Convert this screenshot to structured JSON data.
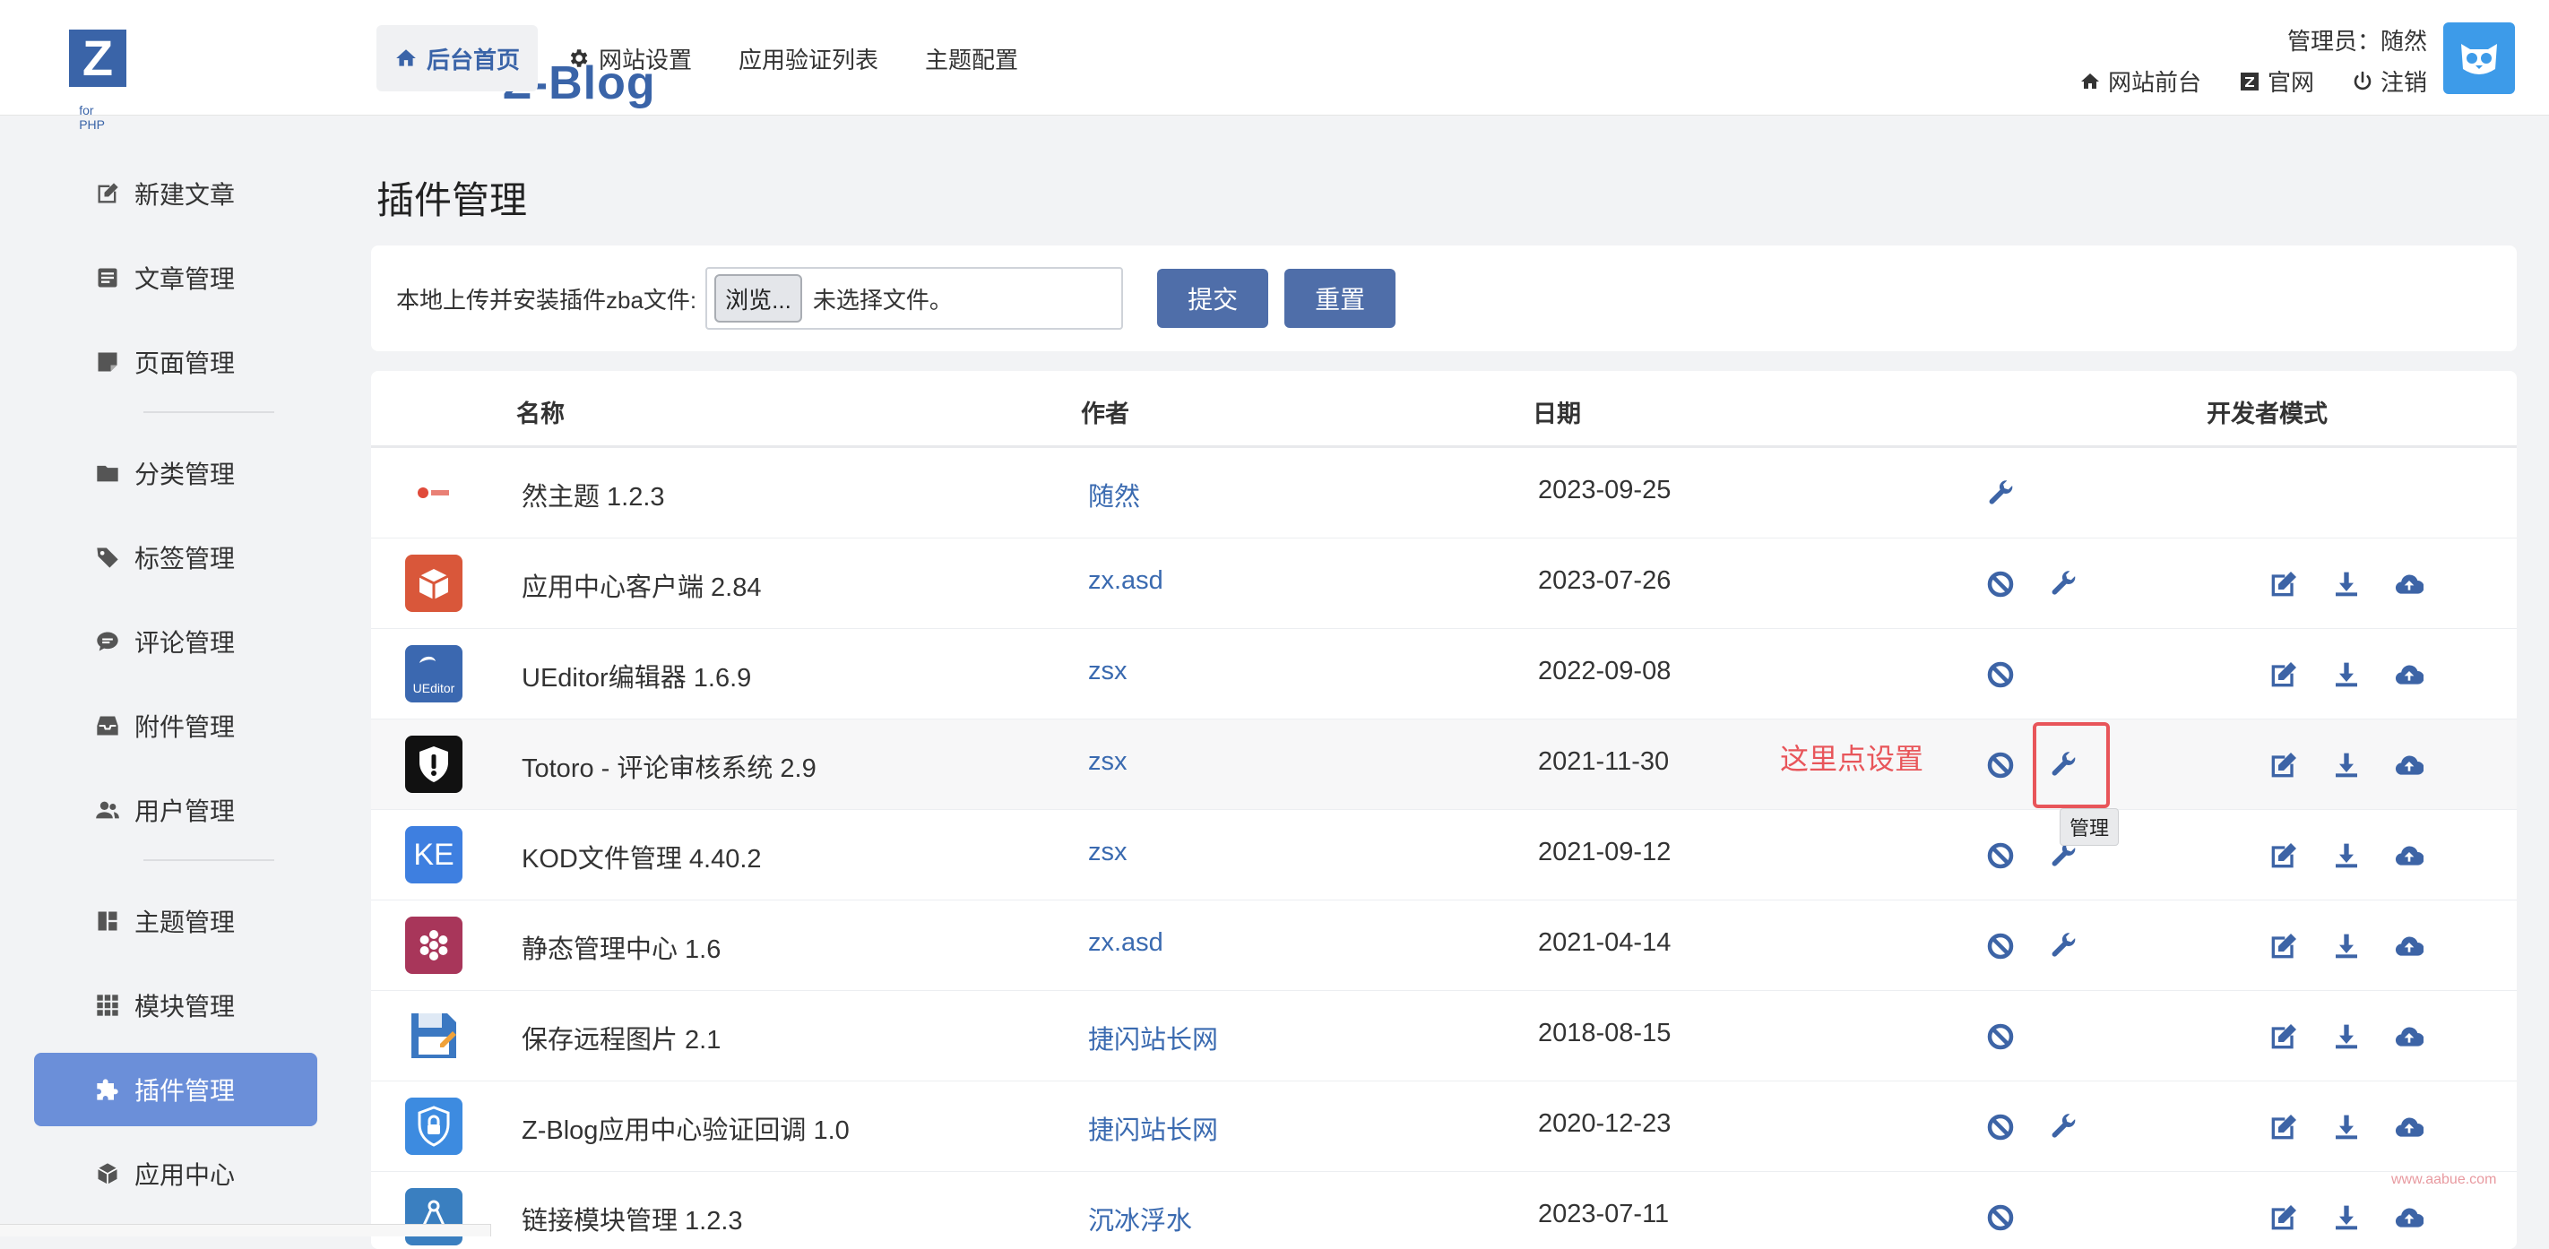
{
  "logo": {
    "letter": "Z",
    "text": "Z-Blog",
    "sub": "for PHP"
  },
  "topnav": [
    {
      "label": "后台首页",
      "icon": "home-icon",
      "active": true
    },
    {
      "label": "网站设置",
      "icon": "gear-icon",
      "active": false
    },
    {
      "label": "应用验证列表",
      "icon": "",
      "active": false
    },
    {
      "label": "主题配置",
      "icon": "",
      "active": false
    }
  ],
  "admin": {
    "label": "管理员：随然",
    "links": [
      {
        "label": "网站前台",
        "icon": "home-icon"
      },
      {
        "label": "官网",
        "icon": "z-logo-icon"
      },
      {
        "label": "注销",
        "icon": "power-icon"
      }
    ]
  },
  "sidebar": {
    "items": [
      {
        "label": "新建文章",
        "icon": "edit-icon"
      },
      {
        "label": "文章管理",
        "icon": "list-icon"
      },
      {
        "label": "页面管理",
        "icon": "page-icon"
      },
      {
        "label": "分类管理",
        "icon": "folder-icon"
      },
      {
        "label": "标签管理",
        "icon": "tag-icon"
      },
      {
        "label": "评论管理",
        "icon": "comment-icon"
      },
      {
        "label": "附件管理",
        "icon": "inbox-icon"
      },
      {
        "label": "用户管理",
        "icon": "users-icon"
      },
      {
        "label": "主题管理",
        "icon": "layout-icon"
      },
      {
        "label": "模块管理",
        "icon": "grid-icon"
      },
      {
        "label": "插件管理",
        "icon": "puzzle-icon",
        "active": true
      },
      {
        "label": "应用中心",
        "icon": "cube-icon"
      }
    ]
  },
  "page_title": "插件管理",
  "upload": {
    "label": "本地上传并安装插件zba文件:",
    "browse_label": "浏览...",
    "file_status": "未选择文件。",
    "submit_label": "提交",
    "reset_label": "重置"
  },
  "table": {
    "headers": {
      "name": "名称",
      "author": "作者",
      "date": "日期",
      "dev": "开发者模式"
    },
    "rows": [
      {
        "name": "然主题 1.2.3",
        "author": "随然",
        "date": "2023-09-25",
        "icon": "ran-theme-icon",
        "disable": false,
        "manage": true,
        "dev": false
      },
      {
        "name": "应用中心客户端 2.84",
        "author": "zx.asd",
        "date": "2023-07-26",
        "icon": "app-center-icon",
        "disable": true,
        "manage": true,
        "dev": true
      },
      {
        "name": "UEditor编辑器 1.6.9",
        "author": "zsx",
        "date": "2022-09-08",
        "icon": "ueditor-icon",
        "disable": true,
        "manage": false,
        "dev": true
      },
      {
        "name": "Totoro - 评论审核系统 2.9",
        "author": "zsx",
        "date": "2021-11-30",
        "icon": "shield-icon",
        "disable": true,
        "manage": true,
        "dev": true
      },
      {
        "name": "KOD文件管理 4.40.2",
        "author": "zsx",
        "date": "2021-09-12",
        "icon": "kod-icon",
        "disable": true,
        "manage": true,
        "dev": true
      },
      {
        "name": "静态管理中心 1.6",
        "author": "zx.asd",
        "date": "2021-04-14",
        "icon": "static-center-icon",
        "disable": true,
        "manage": true,
        "dev": true
      },
      {
        "name": "保存远程图片 2.1",
        "author": "捷闪站长网",
        "date": "2018-08-15",
        "icon": "floppy-icon",
        "disable": true,
        "manage": false,
        "dev": true
      },
      {
        "name": "Z-Blog应用中心验证回调 1.0",
        "author": "捷闪站长网",
        "date": "2020-12-23",
        "icon": "lock-shield-icon",
        "disable": true,
        "manage": true,
        "dev": true
      },
      {
        "name": "链接模块管理 1.2.3",
        "author": "沉冰浮水",
        "date": "2023-07-11",
        "icon": "link-module-icon",
        "disable": true,
        "manage": false,
        "dev": true
      }
    ]
  },
  "annotation": {
    "text": "这里点设置",
    "tooltip": "管理"
  },
  "watermark": "www.aabue.com",
  "ueditor_label": "UEditor",
  "kod_label": "KE",
  "colors": {
    "accent": "#4f6ea9",
    "sidebar_active": "#6b8fd9",
    "link": "#3a6ab0",
    "annotation": "#e8555a"
  }
}
